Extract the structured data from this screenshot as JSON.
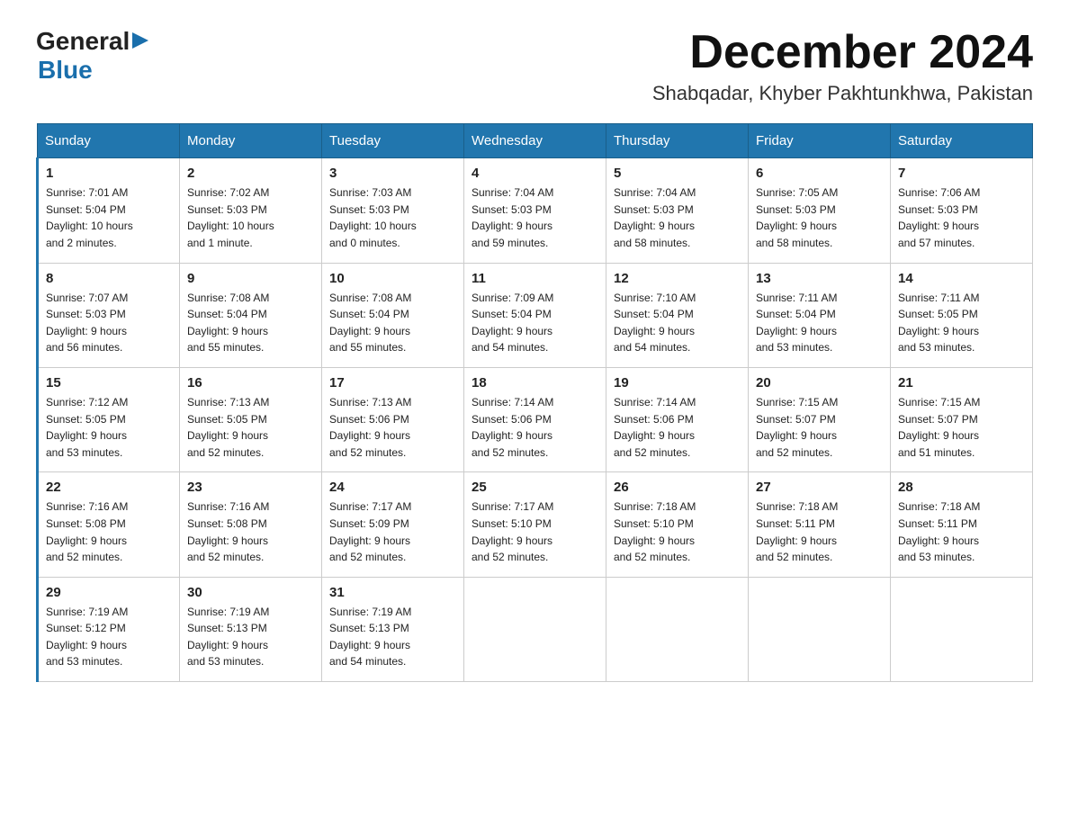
{
  "logo": {
    "text_general": "General",
    "text_blue": "Blue",
    "arrow": "▶"
  },
  "title": "December 2024",
  "location": "Shabqadar, Khyber Pakhtunkhwa, Pakistan",
  "days_of_week": [
    "Sunday",
    "Monday",
    "Tuesday",
    "Wednesday",
    "Thursday",
    "Friday",
    "Saturday"
  ],
  "weeks": [
    [
      {
        "day": "1",
        "sunrise": "7:01 AM",
        "sunset": "5:04 PM",
        "daylight": "10 hours and 2 minutes."
      },
      {
        "day": "2",
        "sunrise": "7:02 AM",
        "sunset": "5:03 PM",
        "daylight": "10 hours and 1 minute."
      },
      {
        "day": "3",
        "sunrise": "7:03 AM",
        "sunset": "5:03 PM",
        "daylight": "10 hours and 0 minutes."
      },
      {
        "day": "4",
        "sunrise": "7:04 AM",
        "sunset": "5:03 PM",
        "daylight": "9 hours and 59 minutes."
      },
      {
        "day": "5",
        "sunrise": "7:04 AM",
        "sunset": "5:03 PM",
        "daylight": "9 hours and 58 minutes."
      },
      {
        "day": "6",
        "sunrise": "7:05 AM",
        "sunset": "5:03 PM",
        "daylight": "9 hours and 58 minutes."
      },
      {
        "day": "7",
        "sunrise": "7:06 AM",
        "sunset": "5:03 PM",
        "daylight": "9 hours and 57 minutes."
      }
    ],
    [
      {
        "day": "8",
        "sunrise": "7:07 AM",
        "sunset": "5:03 PM",
        "daylight": "9 hours and 56 minutes."
      },
      {
        "day": "9",
        "sunrise": "7:08 AM",
        "sunset": "5:04 PM",
        "daylight": "9 hours and 55 minutes."
      },
      {
        "day": "10",
        "sunrise": "7:08 AM",
        "sunset": "5:04 PM",
        "daylight": "9 hours and 55 minutes."
      },
      {
        "day": "11",
        "sunrise": "7:09 AM",
        "sunset": "5:04 PM",
        "daylight": "9 hours and 54 minutes."
      },
      {
        "day": "12",
        "sunrise": "7:10 AM",
        "sunset": "5:04 PM",
        "daylight": "9 hours and 54 minutes."
      },
      {
        "day": "13",
        "sunrise": "7:11 AM",
        "sunset": "5:04 PM",
        "daylight": "9 hours and 53 minutes."
      },
      {
        "day": "14",
        "sunrise": "7:11 AM",
        "sunset": "5:05 PM",
        "daylight": "9 hours and 53 minutes."
      }
    ],
    [
      {
        "day": "15",
        "sunrise": "7:12 AM",
        "sunset": "5:05 PM",
        "daylight": "9 hours and 53 minutes."
      },
      {
        "day": "16",
        "sunrise": "7:13 AM",
        "sunset": "5:05 PM",
        "daylight": "9 hours and 52 minutes."
      },
      {
        "day": "17",
        "sunrise": "7:13 AM",
        "sunset": "5:06 PM",
        "daylight": "9 hours and 52 minutes."
      },
      {
        "day": "18",
        "sunrise": "7:14 AM",
        "sunset": "5:06 PM",
        "daylight": "9 hours and 52 minutes."
      },
      {
        "day": "19",
        "sunrise": "7:14 AM",
        "sunset": "5:06 PM",
        "daylight": "9 hours and 52 minutes."
      },
      {
        "day": "20",
        "sunrise": "7:15 AM",
        "sunset": "5:07 PM",
        "daylight": "9 hours and 52 minutes."
      },
      {
        "day": "21",
        "sunrise": "7:15 AM",
        "sunset": "5:07 PM",
        "daylight": "9 hours and 51 minutes."
      }
    ],
    [
      {
        "day": "22",
        "sunrise": "7:16 AM",
        "sunset": "5:08 PM",
        "daylight": "9 hours and 52 minutes."
      },
      {
        "day": "23",
        "sunrise": "7:16 AM",
        "sunset": "5:08 PM",
        "daylight": "9 hours and 52 minutes."
      },
      {
        "day": "24",
        "sunrise": "7:17 AM",
        "sunset": "5:09 PM",
        "daylight": "9 hours and 52 minutes."
      },
      {
        "day": "25",
        "sunrise": "7:17 AM",
        "sunset": "5:10 PM",
        "daylight": "9 hours and 52 minutes."
      },
      {
        "day": "26",
        "sunrise": "7:18 AM",
        "sunset": "5:10 PM",
        "daylight": "9 hours and 52 minutes."
      },
      {
        "day": "27",
        "sunrise": "7:18 AM",
        "sunset": "5:11 PM",
        "daylight": "9 hours and 52 minutes."
      },
      {
        "day": "28",
        "sunrise": "7:18 AM",
        "sunset": "5:11 PM",
        "daylight": "9 hours and 53 minutes."
      }
    ],
    [
      {
        "day": "29",
        "sunrise": "7:19 AM",
        "sunset": "5:12 PM",
        "daylight": "9 hours and 53 minutes."
      },
      {
        "day": "30",
        "sunrise": "7:19 AM",
        "sunset": "5:13 PM",
        "daylight": "9 hours and 53 minutes."
      },
      {
        "day": "31",
        "sunrise": "7:19 AM",
        "sunset": "5:13 PM",
        "daylight": "9 hours and 54 minutes."
      },
      null,
      null,
      null,
      null
    ]
  ],
  "labels": {
    "sunrise": "Sunrise:",
    "sunset": "Sunset:",
    "daylight": "Daylight:"
  }
}
